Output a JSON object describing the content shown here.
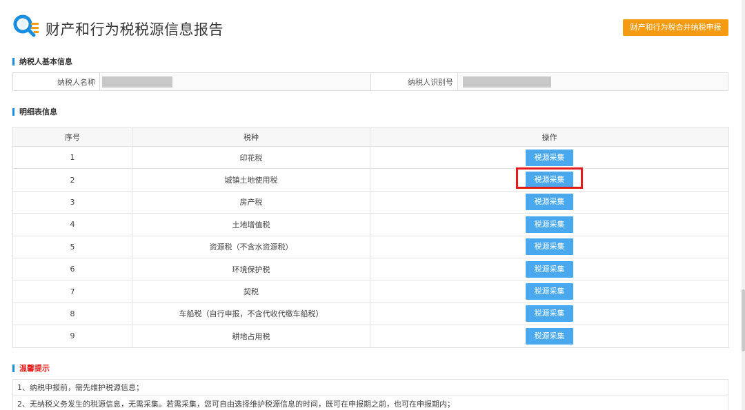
{
  "header": {
    "title": "财产和行为税税源信息报告",
    "combined_button": "财产和行为税合并纳税申报",
    "logo_icon": "search-list-icon",
    "colors": {
      "icon_blue": "#1a8ee1",
      "icon_orange": "#f59b12"
    }
  },
  "taxpayer_section": {
    "title": "纳税人基本信息",
    "name_label": "纳税人名称",
    "id_label": "纳税人识别号"
  },
  "detail_section": {
    "title": "明细表信息",
    "columns": [
      "序号",
      "税种",
      "操作"
    ],
    "button_label": "税源采集",
    "highlighted_row": 2,
    "rows": [
      {
        "no": "1",
        "tax": "印花税"
      },
      {
        "no": "2",
        "tax": "城镇土地使用税"
      },
      {
        "no": "3",
        "tax": "房产税"
      },
      {
        "no": "4",
        "tax": "土地增值税"
      },
      {
        "no": "5",
        "tax": "资源税（不含水资源税）"
      },
      {
        "no": "6",
        "tax": "环境保护税"
      },
      {
        "no": "7",
        "tax": "契税"
      },
      {
        "no": "8",
        "tax": "车船税（自行申报，不含代收代缴车船税）"
      },
      {
        "no": "9",
        "tax": "耕地占用税"
      }
    ]
  },
  "tips_section": {
    "title": "温馨提示",
    "lines": [
      "1、纳税申报前，需先维护税源信息；",
      "2、无纳税义务发生的税源信息，无需采集。若需采集，您可自由选择维护税源信息的时间，既可在申报期之前，也可在申报期内；"
    ]
  },
  "colors": {
    "accent_blue": "#1a8ee1",
    "button_blue": "#4aa8ef",
    "orange": "#f59b12",
    "alert_red": "#e31b1b"
  }
}
